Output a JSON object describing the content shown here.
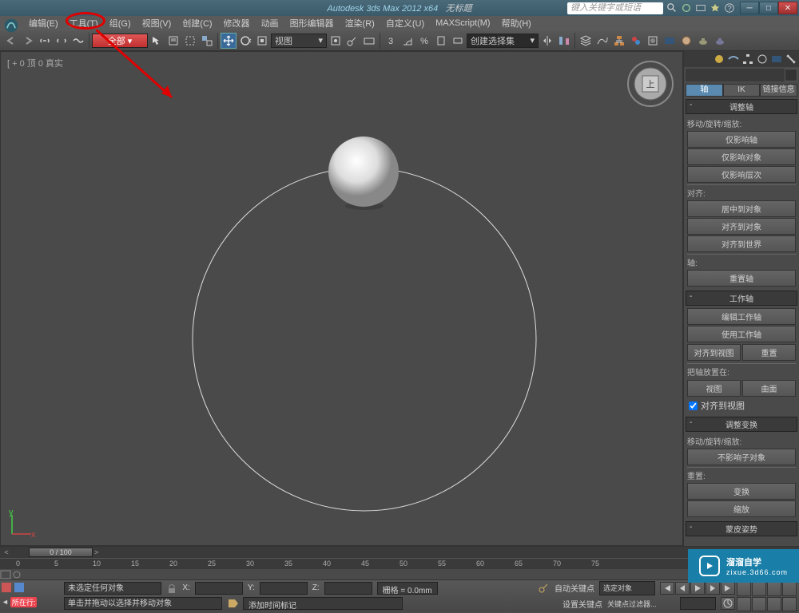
{
  "titlebar": {
    "app_title": "Autodesk 3ds Max 2012 x64",
    "document": "无标题",
    "search_placeholder": "键入关键字或短语"
  },
  "menu": {
    "items": [
      "编辑(E)",
      "工具(T)",
      "组(G)",
      "视图(V)",
      "创建(C)",
      "修改器",
      "动画",
      "图形编辑器",
      "渲染(R)",
      "自定义(U)",
      "MAXScript(M)",
      "帮助(H)"
    ]
  },
  "toolbar": {
    "view_dropdown": "视图",
    "selection_set": "创建选择集"
  },
  "viewport": {
    "label": "[ + 0 顶 0 真实"
  },
  "panel": {
    "tabs": {
      "axis": "轴",
      "ik": "IK",
      "link": "链接信息"
    },
    "rollouts": {
      "adjust_axis": {
        "title": "调整轴",
        "group1_label": "移动/旋转/缩放:",
        "btn_affect_pivot": "仅影响轴",
        "btn_affect_object": "仅影响对象",
        "btn_affect_hierarchy": "仅影响层次",
        "group2_label": "对齐:",
        "btn_center_to_obj": "居中到对象",
        "btn_align_to_obj": "对齐到对象",
        "btn_align_to_world": "对齐到世界",
        "group3_label": "轴:",
        "btn_reset_pivot": "重置轴"
      },
      "working_pivot": {
        "title": "工作轴",
        "btn_edit": "编辑工作轴",
        "btn_use": "使用工作轴",
        "btn_align_view": "对齐到视图",
        "btn_reset": "重置",
        "group_place": "把轴放置在:",
        "btn_view": "视图",
        "btn_surface": "曲面",
        "chk_align_view": "对齐到视图"
      },
      "adjust_transform": {
        "title": "调整变换",
        "group1_label": "移动/旋转/缩放:",
        "btn_dont_affect": "不影响子对象",
        "group2_label": "重置:",
        "btn_transform": "变换",
        "btn_scale": "缩放"
      },
      "skin_pose": {
        "title": "蒙皮姿势"
      }
    }
  },
  "time": {
    "frame_display": "0 / 100",
    "ticks": [
      "0",
      "5",
      "10",
      "15",
      "20",
      "25",
      "30",
      "35",
      "40",
      "45",
      "50",
      "55",
      "60",
      "65",
      "70",
      "75"
    ]
  },
  "status": {
    "auto_key": "自动关键点",
    "set_key": "设置关键点",
    "sel_filter": "选定对象",
    "key_filter": "关键点过滤器...",
    "dropdown_row": "所在行:",
    "msg1": "未选定任何对象",
    "msg2": "单击并拖动以选择并移动对象",
    "add_time_tag": "添加时间标记",
    "x": "X:",
    "y": "Y:",
    "z": "Z:",
    "grid": "栅格 = 0.0mm"
  },
  "watermark": {
    "main": "溜溜自学",
    "sub": "zixue.3d66.com"
  }
}
